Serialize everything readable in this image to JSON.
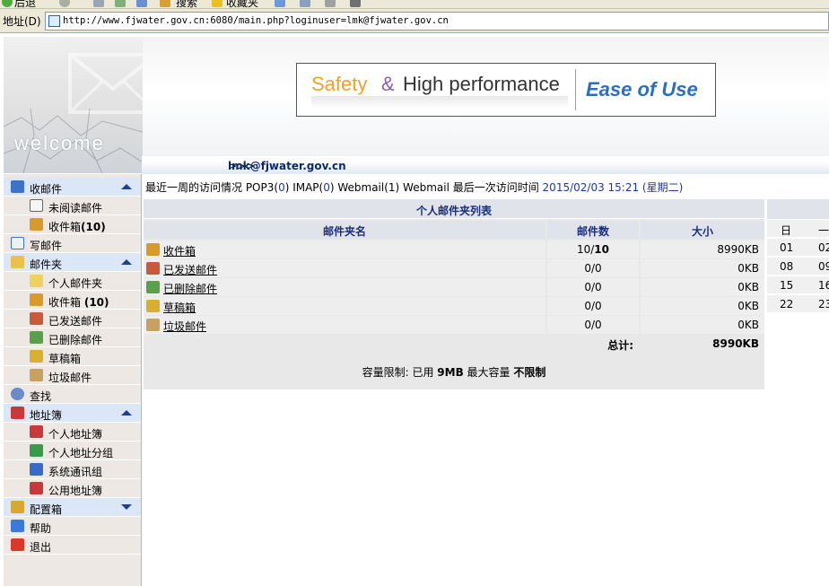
{
  "browser": {
    "toolbar": {
      "back_label": "后退",
      "search_label": "搜索",
      "favorites_label": "收藏夹"
    },
    "address_label": "地址(D)",
    "url": "http://www.fjwater.gov.cn:6080/main.php?loginuser=lmk@fjwater.gov.cn"
  },
  "banner": {
    "welcome": "welcome",
    "slogan": {
      "safety": "Safety",
      "amp": "&",
      "high_performance": "High performance",
      "ease": "Ease of Use"
    },
    "user_prefix": ">>>",
    "user_email": "lmk@fjwater.gov.cn"
  },
  "info": {
    "text_prefix": "最近一周的访问情况 POP3(",
    "pop3": "0",
    "imap_label": ") IMAP(",
    "imap": "0",
    "webmail_label": ") Webmail(1)  Webmail 最后一次访问时间 ",
    "last_visit": "2015/02/03 15:21 (星期二)"
  },
  "sidebar": {
    "inbox_section": "收邮件",
    "unread": "未阅读邮件",
    "inbox": "收件箱",
    "inbox_count": "(10)",
    "compose": "写邮件",
    "folders_section": "邮件夹",
    "personal_folders": "个人邮件夹",
    "inbox2": "收件箱",
    "inbox2_count": "(10)",
    "sent": "已发送邮件",
    "deleted": "已删除邮件",
    "drafts": "草稿箱",
    "junk": "垃圾邮件",
    "search": "查找",
    "addressbook_section": "地址簿",
    "personal_addressbook": "个人地址簿",
    "personal_groups": "个人地址分组",
    "system_groups": "系统通讯组",
    "public_addressbook": "公用地址簿",
    "config_section": "配置箱",
    "help": "帮助",
    "logout": "退出"
  },
  "folders": {
    "title": "个人邮件夹列表",
    "columns": [
      "邮件夹名",
      "邮件数",
      "大小"
    ],
    "rows": [
      {
        "name": "收件箱",
        "count_read": "10/",
        "count_total": "10",
        "size": "8990KB"
      },
      {
        "name": "已发送邮件",
        "count": "0/0",
        "size": "0KB"
      },
      {
        "name": "已删除邮件",
        "count": "0/0",
        "size": "0KB"
      },
      {
        "name": "草稿箱",
        "count": "0/0",
        "size": "0KB"
      },
      {
        "name": "垃圾邮件",
        "count": "0/0",
        "size": "0KB"
      }
    ],
    "total_label": "总计:",
    "total_size": "8990KB",
    "capacity": {
      "prefix": "容量限制: 已用 ",
      "used": "9MB",
      "mid": " 最大容量 ",
      "max": "不限制"
    }
  },
  "calendar": {
    "header": [
      "日",
      "一"
    ],
    "rows": [
      [
        "01",
        "02"
      ],
      [
        "08",
        "09"
      ],
      [
        "15",
        "16"
      ],
      [
        "22",
        "23"
      ]
    ]
  },
  "colors": {
    "nav_head_bg": "#dbe6f7",
    "nav_bg": "#ede8e4",
    "link_blue": "#1a3aa0",
    "table_head": "#e0e4ea"
  }
}
